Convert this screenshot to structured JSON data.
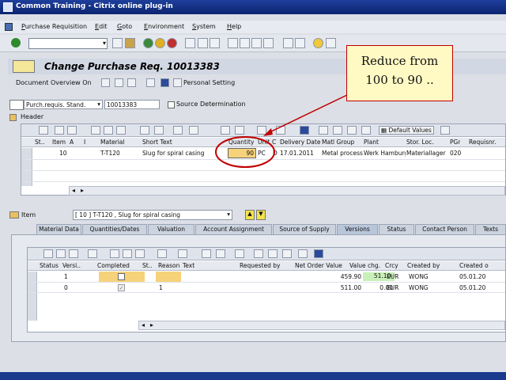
{
  "window": {
    "title": "Common Training - Citrix online plug-in"
  },
  "menu": [
    {
      "label": "Purchase Requisition"
    },
    {
      "label": "Edit"
    },
    {
      "label": "Goto"
    },
    {
      "label": "Environment"
    },
    {
      "label": "System"
    },
    {
      "label": "Help"
    }
  ],
  "header": {
    "title": "Change Purchase Req. 10013383"
  },
  "app_toolbar": {
    "doc_overview": "Document Overview On",
    "personal_setting": "Personal Setting"
  },
  "doc": {
    "type": "Purch.requis. Stand.",
    "number": "10013383",
    "source_determination": "Source Determination",
    "header_label": "Header"
  },
  "items_grid": {
    "default_values": "Default Values",
    "columns": [
      "St..",
      "Item",
      "A",
      "I",
      "Material",
      "Short Text",
      "Quantity",
      "Unit",
      "C",
      "Delivery Date",
      "Matl Group",
      "Plant",
      "Stor. Loc.",
      "PGr",
      "Requisnr."
    ],
    "row": {
      "item": "10",
      "material": "T-T120",
      "short_text": "Slug for spiral casing",
      "quantity": "90",
      "unit": "PC",
      "c": "D",
      "delivery_date": "17.01.2011",
      "matl_group": "Metal process",
      "plant": "Werk Hamburg",
      "stor_loc": "Materiallager",
      "pgr": "020"
    }
  },
  "item_detail": {
    "label": "Item",
    "selected": "[ 10 ] T-T120 , Slug for spiral casing"
  },
  "tabs": [
    {
      "label": "Material Data"
    },
    {
      "label": "Quantities/Dates"
    },
    {
      "label": "Valuation"
    },
    {
      "label": "Account Assignment"
    },
    {
      "label": "Source of Supply"
    },
    {
      "label": "Versions"
    },
    {
      "label": "Status"
    },
    {
      "label": "Contact Person"
    },
    {
      "label": "Texts"
    }
  ],
  "versions_grid": {
    "columns": [
      "Status",
      "Versi..",
      "Completed",
      "St..",
      "Reason",
      "Text",
      "Requested by",
      "Net Order Value",
      "Value chg.",
      "Crcy",
      "Created by",
      "Created o"
    ],
    "rows": [
      {
        "version": "1",
        "reason": "",
        "net_value": "459.90",
        "value_chg": "51.10-",
        "crcy": "EUR",
        "created_by": "WONG",
        "created_on": "05.01.20"
      },
      {
        "version": "0",
        "reason": "1",
        "net_value": "511.00",
        "value_chg": "0.00",
        "crcy": "EUR",
        "created_by": "WONG",
        "created_on": "05.01.20"
      }
    ]
  },
  "callout": {
    "line1": "Reduce from",
    "line2": "100 to 90 .."
  },
  "colors": {
    "title_bar": "#1f3f9c",
    "highlight_cell": "#f6d27a",
    "value_chg_highlight": "#c8f0b8",
    "annotation_red": "#c00000"
  }
}
